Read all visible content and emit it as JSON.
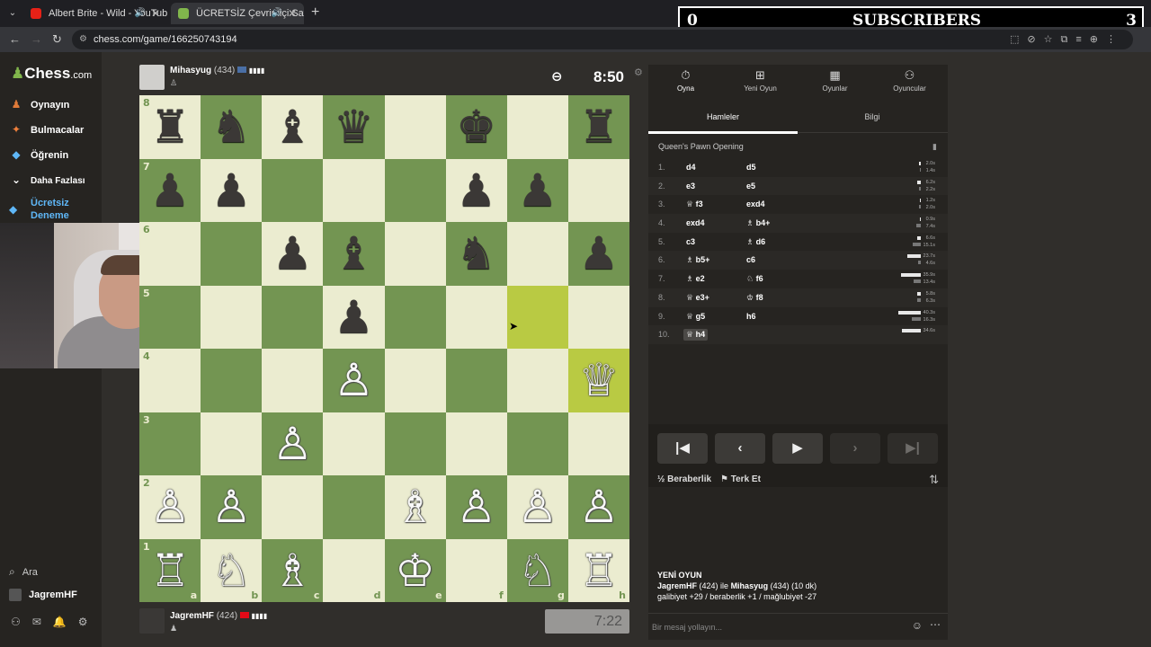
{
  "browser": {
    "tabs": [
      {
        "label": "Albert Brite - Wild - YouTube"
      },
      {
        "label": "ÜCRETSİZ Çevrimiçi Satranç"
      }
    ],
    "url": "chess.com/game/166250743194"
  },
  "overlay": {
    "count_left": "0",
    "label": "SUBSCRIBERS",
    "count_right": "3"
  },
  "sidebar": {
    "logo": "Chess",
    "logo_suffix": ".com",
    "items": [
      {
        "label": "Oynayın",
        "icon": "pawn-icon"
      },
      {
        "label": "Bulmacalar",
        "icon": "puzzle-icon"
      },
      {
        "label": "Öğrenin",
        "icon": "learn-icon"
      },
      {
        "label": "Daha Fazlası",
        "icon": "chevron-down-icon"
      }
    ],
    "trial_line1": "Ücretsiz",
    "trial_line2": "Deneme",
    "search": "Ara",
    "user": "JagremHF"
  },
  "top_player": {
    "name": "Mihasyug",
    "rating": "(434)",
    "clock": "8:50"
  },
  "bottom_player": {
    "name": "JagremHF",
    "rating": "(424)",
    "clock": "7:22"
  },
  "board": {
    "ranks": [
      "8",
      "7",
      "6",
      "5",
      "4",
      "3",
      "2",
      "1"
    ],
    "files": [
      "a",
      "b",
      "c",
      "d",
      "e",
      "f",
      "g",
      "h"
    ],
    "pieces": [
      [
        "♜",
        "♞",
        "♝",
        "♛",
        "",
        "♚",
        "",
        "♜"
      ],
      [
        "♟",
        "♟",
        "",
        "",
        "",
        "♟",
        "♟",
        ""
      ],
      [
        "",
        "",
        "♟",
        "♝",
        "",
        "♞",
        "",
        "♟"
      ],
      [
        "",
        "",
        "",
        "♟",
        "",
        "",
        "",
        ""
      ],
      [
        "",
        "",
        "",
        "♙",
        "",
        "",
        "",
        "♕"
      ],
      [
        "",
        "",
        "♙",
        "",
        "",
        "",
        "",
        ""
      ],
      [
        "♙",
        "♙",
        "",
        "",
        "♗",
        "♙",
        "♙",
        "♙"
      ],
      [
        "♖",
        "♘",
        "♗",
        "",
        "♔",
        "",
        "♘",
        "♖"
      ]
    ],
    "highlight": [
      "g5",
      "h4"
    ]
  },
  "panel": {
    "tabs": [
      {
        "label": "Oyna",
        "icon": "stopwatch-icon"
      },
      {
        "label": "Yeni Oyun",
        "icon": "plus-icon"
      },
      {
        "label": "Oyunlar",
        "icon": "board-icon"
      },
      {
        "label": "Oyuncular",
        "icon": "players-icon"
      }
    ],
    "subtabs": [
      "Hamleler",
      "Bilgi"
    ],
    "opening": "Queen's Pawn Opening",
    "moves": [
      {
        "no": "1.",
        "w": "d4",
        "b": "d5",
        "tw": "2.0s",
        "tb": "1.4s",
        "fw": 0.06,
        "fb": 0.04
      },
      {
        "no": "2.",
        "w": "e3",
        "b": "e5",
        "tw": "6.2s",
        "tb": "2.2s",
        "fw": 0.15,
        "fb": 0.06
      },
      {
        "no": "3.",
        "w": "♕ f3",
        "b": "exd4",
        "tw": "1.2s",
        "tb": "2.0s",
        "fw": 0.04,
        "fb": 0.06
      },
      {
        "no": "4.",
        "w": "exd4",
        "b": "♗ b4+",
        "tw": "0.9s",
        "tb": "7.4s",
        "fw": 0.03,
        "fb": 0.18
      },
      {
        "no": "5.",
        "w": "c3",
        "b": "♗ d6",
        "tw": "6.6s",
        "tb": "15.1s",
        "fw": 0.16,
        "fb": 0.36
      },
      {
        "no": "6.",
        "w": "♗ b5+",
        "b": "c6",
        "tw": "23.7s",
        "tb": "4.6s",
        "fw": 0.56,
        "fb": 0.11
      },
      {
        "no": "7.",
        "w": "♗ e2",
        "b": "♘ f6",
        "tw": "35.9s",
        "tb": "13.4s",
        "fw": 0.85,
        "fb": 0.32
      },
      {
        "no": "8.",
        "w": "♕ e3+",
        "b": "♔ f8",
        "tw": "5.8s",
        "tb": "6.3s",
        "fw": 0.14,
        "fb": 0.15
      },
      {
        "no": "9.",
        "w": "♕ g5",
        "b": "h6",
        "tw": "40.3s",
        "tb": "16.3s",
        "fw": 0.95,
        "fb": 0.39
      },
      {
        "no": "10.",
        "w": "♕ h4",
        "b": "",
        "tw": "34.6s",
        "tb": "",
        "fw": 0.82,
        "fb": 0
      }
    ],
    "draw": "Beraberlik",
    "resign": "Terk Et",
    "new_game_title": "YENİ OYUN",
    "new_game_line1_a": "JagremHF",
    "new_game_line1_b": "(424) ile",
    "new_game_line1_c": "Mihasyug",
    "new_game_line1_d": "(434) (10 dk)",
    "new_game_line2": "galibiyet +29 / beraberlik +1 / mağlubiyet -27",
    "chat_placeholder": "Bir mesaj yollayın..."
  }
}
